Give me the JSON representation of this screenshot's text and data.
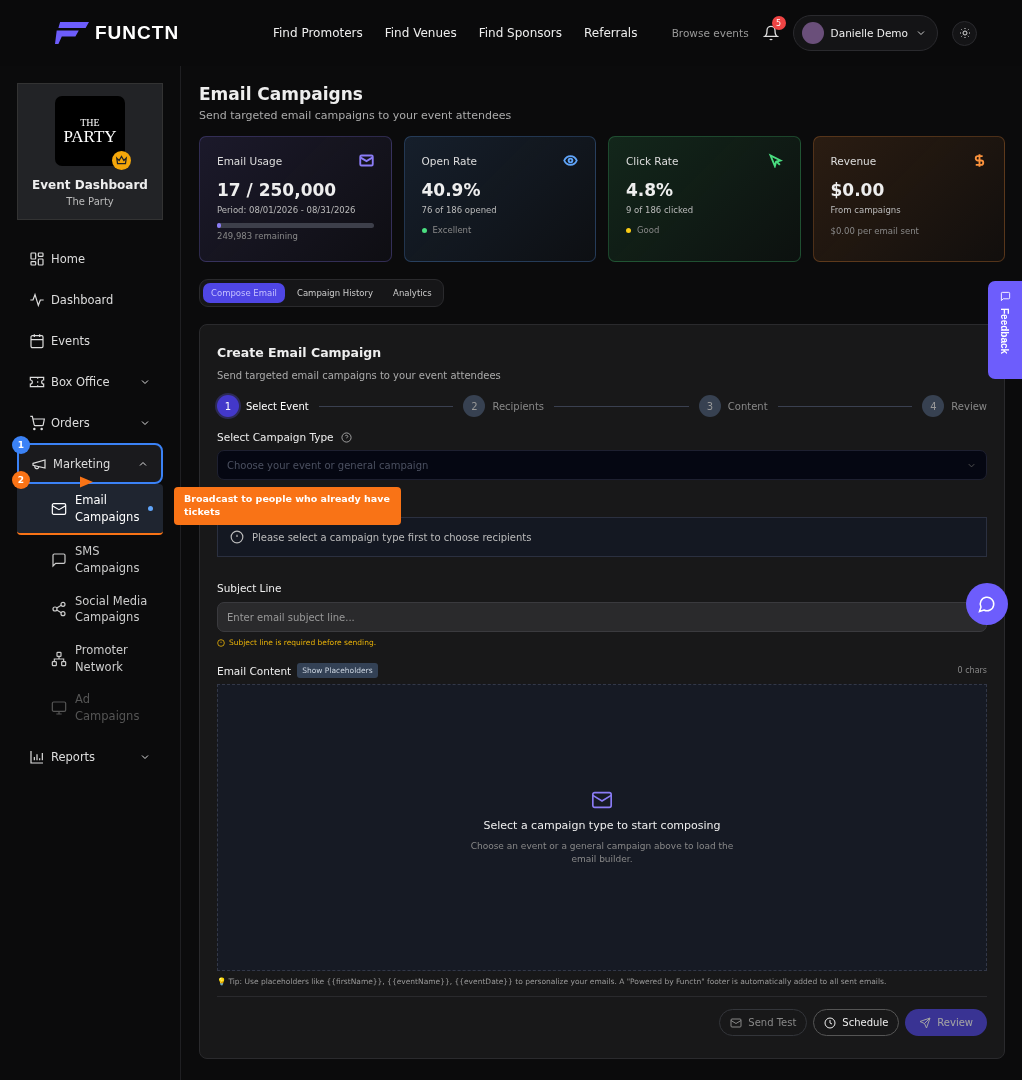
{
  "header": {
    "logo": "FUNCTN",
    "nav": [
      "Find Promoters",
      "Find Venues",
      "Find Sponsors",
      "Referrals"
    ],
    "browse": "Browse events",
    "notifications": "5",
    "user": "Danielle Demo"
  },
  "sidebar": {
    "event_logo": {
      "line_1": "THE",
      "line_2": "PARTY"
    },
    "title": "Event Dashboard",
    "subtitle": "The Party",
    "items": [
      {
        "label": "Home",
        "expanded": false,
        "has_children": false
      },
      {
        "label": "Dashboard",
        "expanded": false,
        "has_children": false
      },
      {
        "label": "Events",
        "expanded": false,
        "has_children": false
      },
      {
        "label": "Box Office",
        "expanded": false,
        "has_children": true
      },
      {
        "label": "Orders",
        "expanded": false,
        "has_children": true
      },
      {
        "label": "Marketing",
        "expanded": true,
        "has_children": true,
        "children": [
          {
            "label": "Email Campaigns",
            "selected": true,
            "disabled": false
          },
          {
            "label": "SMS Campaigns",
            "selected": false,
            "disabled": false
          },
          {
            "label": "Social Media Campaigns",
            "selected": false,
            "disabled": false
          },
          {
            "label": "Promoter Network",
            "selected": false,
            "disabled": false
          },
          {
            "label": "Ad Campaigns",
            "selected": false,
            "disabled": true
          }
        ]
      },
      {
        "label": "Reports",
        "expanded": false,
        "has_children": true
      }
    ]
  },
  "tour": {
    "step_1": "1",
    "step_2": "2",
    "tooltip": "Broadcast to people who already have tickets"
  },
  "page": {
    "title": "Email Campaigns",
    "subtitle": "Send targeted email campaigns to your event attendees"
  },
  "stats": [
    {
      "kind": "usage",
      "label": "Email Usage",
      "color": "#8b7cf6",
      "value": "17 / 250,000",
      "detail": "Period: 08/01/2026 - 08/31/2026",
      "level": 0.0,
      "note": "249,983 remaining"
    },
    {
      "kind": "status",
      "label": "Open Rate",
      "color": "#60a5fa",
      "value": "40.9%",
      "detail": "76 of 186 opened",
      "status": {
        "label": "Excellent",
        "color": "#4ade80"
      }
    },
    {
      "kind": "status",
      "label": "Click Rate",
      "color": "#4ade80",
      "value": "4.8%",
      "detail": "9 of 186 clicked",
      "status": {
        "label": "Good",
        "color": "#facc15"
      }
    },
    {
      "kind": "note",
      "label": "Revenue",
      "color": "#fb923c",
      "value": "$0.00",
      "detail": "From campaigns",
      "note": "$0.00 per email sent"
    }
  ],
  "tabs": [
    {
      "label": "Compose Email",
      "selected": true
    },
    {
      "label": "Campaign History",
      "selected": false
    },
    {
      "label": "Analytics",
      "selected": false
    }
  ],
  "form": {
    "title": "Create Email Campaign",
    "subtitle": "Send targeted email campaigns to your event attendees",
    "steps": [
      {
        "number": "1",
        "label": "Select Event",
        "selected": true
      },
      {
        "number": "2",
        "label": "Recipients",
        "selected": false
      },
      {
        "number": "3",
        "label": "Content",
        "selected": false
      },
      {
        "number": "4",
        "label": "Review",
        "selected": false
      }
    ],
    "campaign_type_label": "Select Campaign Type",
    "campaign_type_placeholder": "Choose your event or general campaign",
    "recipients_notice": "Please select a campaign type first to choose recipients",
    "subject_label": "Subject Line",
    "subject_placeholder": "Enter email subject line...",
    "subject_warning": "Subject line is required before sending.",
    "content_label": "Email Content",
    "placeholders_button": "Show Placeholders",
    "char_count": "0 chars",
    "empty_title": "Select a campaign type to start composing",
    "empty_text": "Choose an event or a general campaign above to load the email builder.",
    "tip": "💡 Tip: Use placeholders like {{firstName}}, {{eventName}}, {{eventDate}} to personalize your emails. A \"Powered by Functn\" footer is automatically added to all sent emails.",
    "buttons": [
      {
        "label": "Send Test",
        "kind": "outline",
        "disabled": false
      },
      {
        "label": "Schedule",
        "kind": "outline-strong",
        "disabled": false
      },
      {
        "label": "Review",
        "kind": "primary",
        "disabled": true
      }
    ]
  },
  "feedback": "Feedback"
}
